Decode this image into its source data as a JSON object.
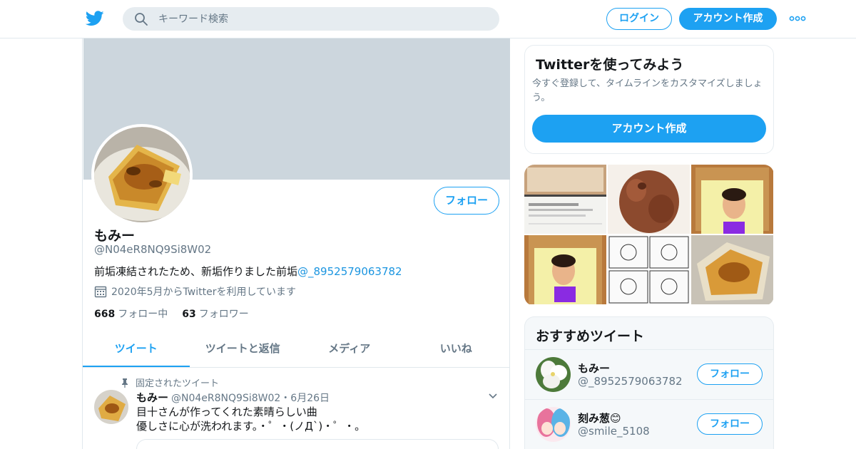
{
  "topbar": {
    "search_placeholder": "キーワード検索",
    "login_label": "ログイン",
    "signup_label": "アカウント作成"
  },
  "profile": {
    "follow_label": "フォロー",
    "name": "もみー",
    "handle": "@N04eR8NQ9Si8W02",
    "bio_text": "前垢凍結されたため、新垢作りました前垢",
    "bio_link": "@_8952579063782",
    "joined": "2020年5月からTwitterを利用しています",
    "following_count": "668",
    "following_label": "フォロー中",
    "followers_count": "63",
    "followers_label": "フォロワー"
  },
  "tabs": [
    "ツイート",
    "ツイートと返信",
    "メディア",
    "いいね"
  ],
  "pinned_tweet": {
    "pinned_label": "固定されたツイート",
    "author_name": "もみー",
    "author_handle": "@N04eR8NQ9Si8W02",
    "sep": "・",
    "date": "6月26日",
    "line1": "目十さんが作ってくれた素晴らしい曲",
    "line2": "優しさに心が洗われます。・゜・(ノД`)・゜・。"
  },
  "signup_card": {
    "title": "Twitterを使ってみよう",
    "text": "今すぐ登録して、タイムラインをカスタマイズしましょう。",
    "button": "アカウント作成"
  },
  "recommend": {
    "title": "おすすめツイート",
    "items": [
      {
        "name": "もみー",
        "handle": "@_8952579063782",
        "follow": "フォロー"
      },
      {
        "name": "刻み葱😊",
        "handle": "@smile_5108",
        "follow": "フォロー"
      }
    ]
  },
  "colors": {
    "accent": "#1da1f2",
    "link": "#1b95e0",
    "banner": "#ccd6dd",
    "muted": "#657786"
  },
  "icons": [
    "twitter-bird-icon",
    "search-icon",
    "more-icon",
    "calendar-icon",
    "pin-icon",
    "chevron-down-icon"
  ]
}
